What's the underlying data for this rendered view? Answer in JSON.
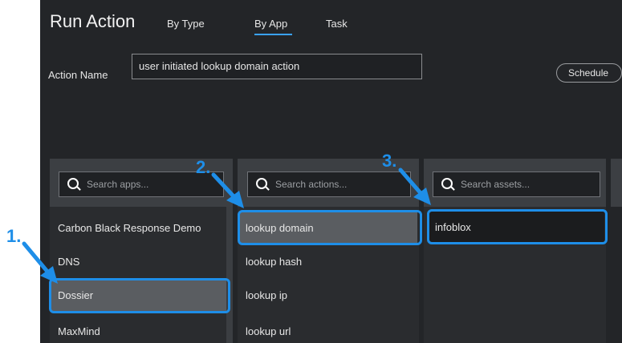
{
  "header": {
    "title": "Run Action",
    "tabs": [
      {
        "label": "By Type"
      },
      {
        "label": "By App"
      },
      {
        "label": "Task"
      }
    ]
  },
  "form": {
    "action_name_label": "Action Name",
    "action_name_value": "user initiated lookup domain action",
    "schedule_label": "Schedule"
  },
  "columns": {
    "apps": {
      "placeholder": "Search apps...",
      "items": [
        "Carbon Black Response Demo",
        "DNS",
        "Dossier",
        "MaxMind"
      ],
      "selected": "Dossier"
    },
    "actions": {
      "placeholder": "Search actions...",
      "items": [
        "lookup domain",
        "lookup hash",
        "lookup ip",
        "lookup url"
      ],
      "selected": "lookup domain"
    },
    "assets": {
      "placeholder": "Search assets...",
      "items": [
        "infoblox"
      ],
      "selected": "infoblox"
    }
  },
  "annotations": {
    "step1": "1.",
    "step2": "2.",
    "step3": "3.",
    "color": "#1e8ee8"
  }
}
